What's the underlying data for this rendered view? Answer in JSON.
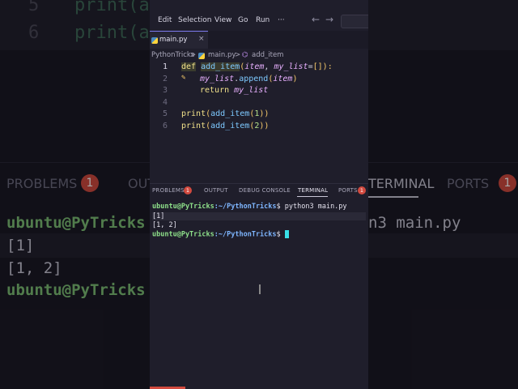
{
  "background": {
    "code_lines": [
      {
        "num": "5",
        "text": "print(a"
      },
      {
        "num": "6",
        "text": "print(a"
      }
    ],
    "panel_tabs": {
      "problems": "PROBLEMS",
      "problems_count": "1",
      "output": "OUT",
      "terminal": "TERMINAL",
      "ports": "PORTS",
      "ports_count": "1"
    },
    "terminal": {
      "prompt": "ubuntu@PyTricks",
      "cmd": "n3 main.py",
      "out1": "[1]",
      "out2": "[1, 2]",
      "prompt2": "ubuntu@PyTricks"
    }
  },
  "menu": {
    "edit": "Edit",
    "selection": "Selection",
    "view": "View",
    "go": "Go",
    "run": "Run",
    "more": "···"
  },
  "tab": {
    "label": "main.py",
    "close": "×"
  },
  "breadcrumb": {
    "folder": "PythonTricks",
    "sep1": ">",
    "file": "main.py",
    "sep2": ">",
    "symbol": "add_item"
  },
  "editor": {
    "lines": [
      "1",
      "2",
      "3",
      "4",
      "5",
      "6"
    ],
    "l1": {
      "def": "def",
      "name": "add_item",
      "open": "(",
      "p1": "item",
      "comma": ", ",
      "p2": "my_list",
      "eq": "=",
      "br": "[]",
      "close": "):"
    },
    "l2": {
      "obj": "my_list",
      "dot": ".",
      "method": "append",
      "open": "(",
      "arg": "item",
      "close": ")"
    },
    "l3": {
      "kw": "return",
      "val": "my_list"
    },
    "l5": {
      "fn": "print",
      "open": "(",
      "inner": "add_item",
      "open2": "(",
      "num": "1",
      "close": "))"
    },
    "l6": {
      "fn": "print",
      "open": "(",
      "inner": "add_item",
      "open2": "(",
      "num": "2",
      "close": "))"
    }
  },
  "panel": {
    "problems": "PROBLEMS",
    "problems_count": "1",
    "output": "OUTPUT",
    "debug": "DEBUG CONSOLE",
    "terminal": "TERMINAL",
    "ports": "PORTS",
    "ports_count": "1"
  },
  "terminal": {
    "user": "ubuntu@PyTricks",
    "path": ":~/PythonTricks",
    "dollar": "$",
    "cmd": " python3 main.py",
    "out1": "[1]",
    "out2": "[1, 2]"
  },
  "colors": {
    "accent": "#7e7cf0",
    "badge": "#d24a3f",
    "cursor": "#39e0e8"
  }
}
